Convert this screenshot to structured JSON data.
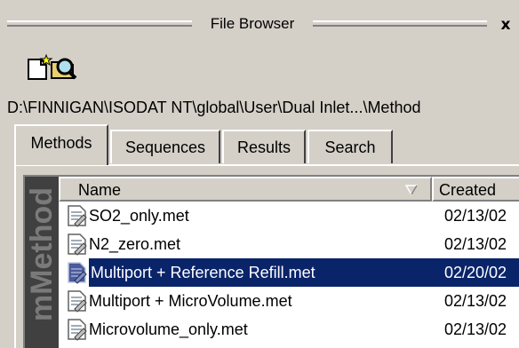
{
  "window": {
    "title": "File Browser",
    "close_label": "x"
  },
  "toolbar": {
    "items": [
      {
        "icon": "new-file-icon"
      },
      {
        "icon": "find-icon"
      }
    ]
  },
  "path": "D:\\FINNIGAN\\ISODAT NT\\global\\User\\Dual Inlet...\\Method",
  "tabs": [
    {
      "label": "Methods",
      "active": true
    },
    {
      "label": "Sequences",
      "active": false
    },
    {
      "label": "Results",
      "active": false
    },
    {
      "label": "Search",
      "active": false
    }
  ],
  "banner_text": "mMethod",
  "list": {
    "columns": [
      "Name",
      "Created"
    ],
    "rows": [
      {
        "name": "SO2_only.met",
        "created": "02/13/02",
        "selected": false
      },
      {
        "name": "N2_zero.met",
        "created": "02/13/02",
        "selected": false
      },
      {
        "name": "Multiport + Reference Refill.met",
        "created": "02/20/02",
        "selected": true
      },
      {
        "name": "Multiport + MicroVolume.met",
        "created": "02/13/02",
        "selected": false
      },
      {
        "name": "Microvolume_only.met",
        "created": "02/13/02",
        "selected": false
      }
    ]
  },
  "colors": {
    "face": "#d4d0c8",
    "selection": "#0a246a"
  }
}
